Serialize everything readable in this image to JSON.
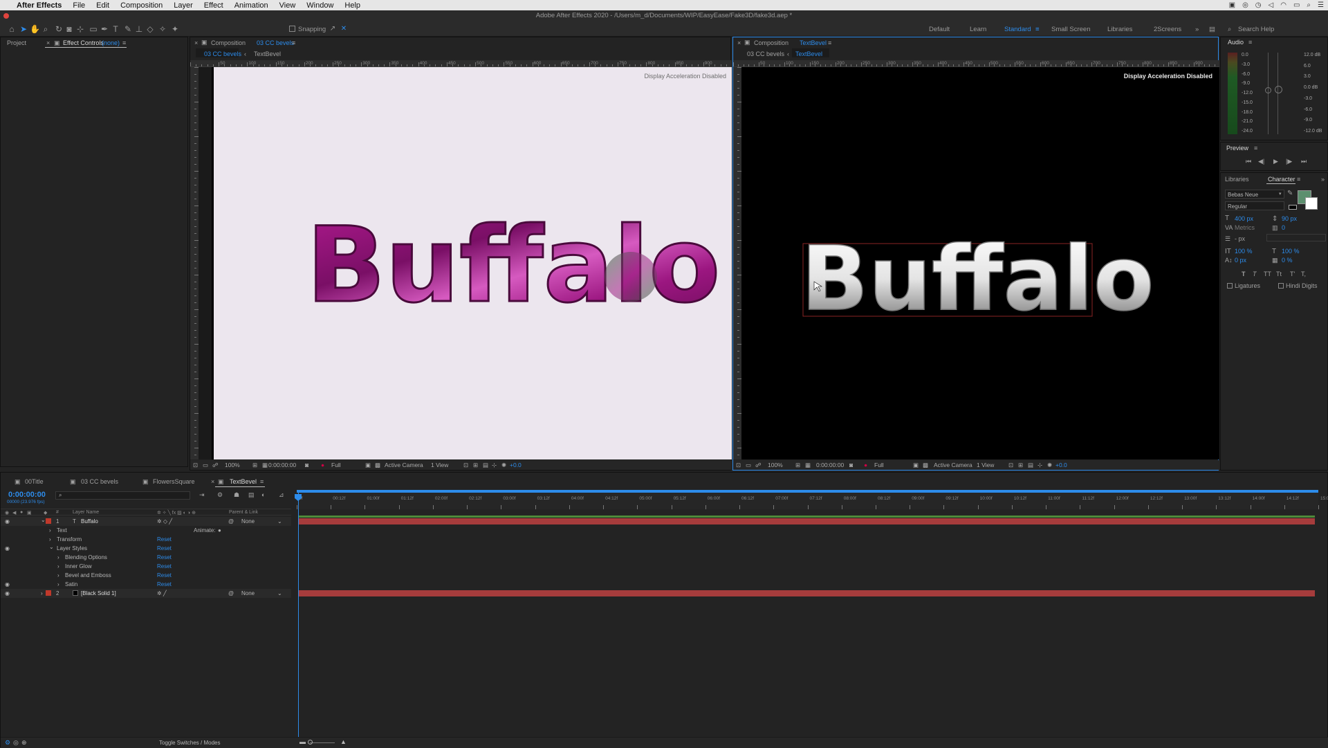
{
  "menubar": {
    "apple": "",
    "app_name": "After Effects",
    "items": [
      "File",
      "Edit",
      "Composition",
      "Layer",
      "Effect",
      "Animation",
      "View",
      "Window",
      "Help"
    ]
  },
  "window_title": "Adobe After Effects 2020 - /Users/m_d/Documents/WIP/EasyEase/Fake3D/fake3d.aep *",
  "toolbar": {
    "snapping_label": "Snapping",
    "workspaces": [
      "Default",
      "Learn",
      "Standard",
      "Small Screen",
      "Libraries",
      "2Screens"
    ],
    "active_workspace": "Standard",
    "search_placeholder": "Search Help"
  },
  "left_panel": {
    "tab_project": "Project",
    "tab_effect_controls": "Effect Controls",
    "effect_controls_target": "(none)"
  },
  "viewer_left": {
    "header_prefix": "Composition",
    "comp_name": "03 CC bevels",
    "tabs": [
      "03 CC bevels",
      "TextBevel"
    ],
    "overlay": "Display Acceleration Disabled",
    "text": "Buffalo",
    "bottom": {
      "zoom": "100%",
      "timecode": "0:00:00:00",
      "resolution": "Full",
      "camera": "Active Camera",
      "views": "1 View",
      "exposure": "+0.0"
    },
    "bg": "#ece6ee"
  },
  "viewer_right": {
    "header_prefix": "Composition",
    "comp_name": "TextBevel",
    "tabs": [
      "03 CC bevels",
      "TextBevel"
    ],
    "overlay": "Display Acceleration Disabled",
    "text": "Buffalo",
    "bottom": {
      "zoom": "100%",
      "timecode": "0:00:00:00",
      "resolution": "Full",
      "camera": "Active Camera",
      "views": "1 View",
      "exposure": "+0.0"
    },
    "bg": "#000000"
  },
  "ruler_labels": [
    "50",
    "100",
    "150",
    "200",
    "250",
    "300",
    "350",
    "400",
    "450",
    "500",
    "550",
    "600",
    "650",
    "700",
    "750",
    "800",
    "850",
    "900"
  ],
  "audio": {
    "title": "Audio",
    "left_scale": [
      "0.0",
      "-3.0",
      "-6.0",
      "-9.0",
      "-12.0",
      "-15.0",
      "-18.0",
      "-21.0",
      "-24.0"
    ],
    "right_scale": [
      "12.0 dB",
      "6.0",
      "3.0",
      "0.0 dB",
      "-3.0",
      "-6.0",
      "-9.0",
      "-12.0 dB"
    ]
  },
  "preview": {
    "title": "Preview"
  },
  "character": {
    "tab_libraries": "Libraries",
    "tab_character": "Character",
    "font": "Bebas Neue",
    "style": "Regular",
    "font_size": "400 px",
    "leading": "90 px",
    "kerning": "Metrics",
    "tracking": "0",
    "stroke_width": "- px",
    "vscale": "100 %",
    "hscale": "100 %",
    "baseline": "0 px",
    "tsume": "0 %",
    "styles": [
      "T",
      "T",
      "TT",
      "Tt",
      "T'",
      "T,"
    ],
    "ligatures": "Ligatures",
    "hindi_digits": "Hindi Digits",
    "fill_color": "#5c8f6e"
  },
  "timeline": {
    "tabs": [
      "00Title",
      "03 CC bevels",
      "FlowersSquare",
      "TextBevel"
    ],
    "active_tab": "TextBevel",
    "timecode": "0:00:00:00",
    "fps": "00000 (23.976 fps)",
    "col_layer_name": "Layer Name",
    "col_parent": "Parent & Link",
    "layers": [
      {
        "num": "1",
        "name": "Buffalo",
        "parent": "None",
        "type": "T"
      },
      {
        "num": "2",
        "name": "[Black Solid 1]",
        "parent": "None",
        "type": ""
      }
    ],
    "props": [
      {
        "name": "Text",
        "action": "Animate:",
        "indent": 0
      },
      {
        "name": "Transform",
        "action": "Reset",
        "indent": 0
      },
      {
        "name": "Layer Styles",
        "action": "Reset",
        "indent": 0
      },
      {
        "name": "Blending Options",
        "action": "Reset",
        "indent": 1
      },
      {
        "name": "Inner Glow",
        "action": "Reset",
        "indent": 1
      },
      {
        "name": "Bevel and Emboss",
        "action": "Reset",
        "indent": 1
      },
      {
        "name": "Satin",
        "action": "Reset",
        "indent": 1
      }
    ],
    "time_marks": [
      "0f",
      "00:12f",
      "01:00f",
      "01:12f",
      "02:00f",
      "02:12f",
      "03:00f",
      "03:12f",
      "04:00f",
      "04:12f",
      "05:00f",
      "05:12f",
      "06:00f",
      "06:12f",
      "07:00f",
      "07:12f",
      "08:00f",
      "08:12f",
      "09:00f",
      "09:12f",
      "10:00f",
      "10:12f",
      "11:00f",
      "11:12f",
      "12:00f",
      "12:12f",
      "13:00f",
      "13:12f",
      "14:00f",
      "14:12f",
      "15:0"
    ],
    "toggle_label": "Toggle Switches / Modes"
  },
  "colors": {
    "accent": "#2d8ceb",
    "track_red": "#a63c3c",
    "track_green": "#4f8a3a",
    "label_red": "#c0392b"
  }
}
